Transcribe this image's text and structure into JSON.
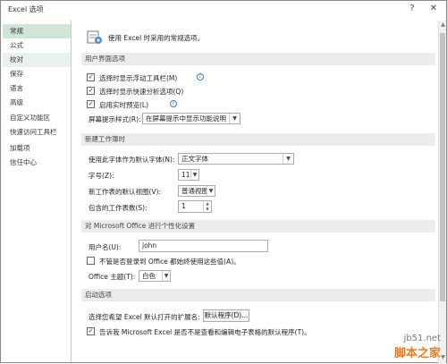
{
  "window": {
    "title": "Excel 选项",
    "help_glyph": "?",
    "close_glyph": "✕"
  },
  "sidebar": {
    "items": [
      {
        "label": "常规",
        "state": "active"
      },
      {
        "label": "公式"
      },
      {
        "label": "校对",
        "state": "hover"
      },
      {
        "label": "保存"
      },
      {
        "label": "语言"
      },
      {
        "label": "高级"
      },
      {
        "label": "自定义功能区"
      },
      {
        "label": "快速访问工具栏"
      },
      {
        "label": "加载项"
      },
      {
        "label": "信任中心"
      }
    ]
  },
  "header": {
    "text": "使用 Excel 时采用的常规选项。"
  },
  "ui_section": {
    "title": "用户界面选项",
    "options": [
      {
        "label": "选择时显示浮动工具栏(M)",
        "checked": true
      },
      {
        "label": "选择时显示快速分析选项(Q)",
        "checked": true
      },
      {
        "label": "启用实时预览(L)",
        "checked": true
      }
    ],
    "screentip_label": "屏幕提示样式(R):",
    "screentip_value": "在屏幕提示中显示功能说明"
  },
  "workbook_section": {
    "title": "新建工作簿时",
    "font_label": "使用此字体作为默认字体(N):",
    "font_value": "正文字体",
    "size_label": "字号(Z):",
    "size_value": "11",
    "view_label": "新工作表的默认视图(V):",
    "view_value": "普通视图",
    "sheets_label": "包含的工作表数(S):",
    "sheets_value": "1"
  },
  "personalize_section": {
    "title": "对 Microsoft Office 进行个性化设置",
    "username_label": "用户名(U):",
    "username_value": "john",
    "always_use_label": "不管是否登录到 Office 都始终使用这些值(A)。",
    "always_use_checked": false,
    "theme_label": "Office 主题(T):",
    "theme_value": "白色"
  },
  "startup_section": {
    "title": "启动选项",
    "ext_label": "选择您希望 Excel 默认打开的扩展名:",
    "default_programs_button": "默认程序(D)...",
    "notify_label": "告诉我 Microsoft Excel 是否不是查看和编辑电子表格的默认程序(T)。",
    "notify_checked": true
  },
  "watermark": {
    "url": "jb51.net",
    "logo": "脚本之家"
  },
  "colors": {
    "accent": "#cfe5d6",
    "section_bg": "#ececec",
    "info": "#3a7fc4"
  }
}
